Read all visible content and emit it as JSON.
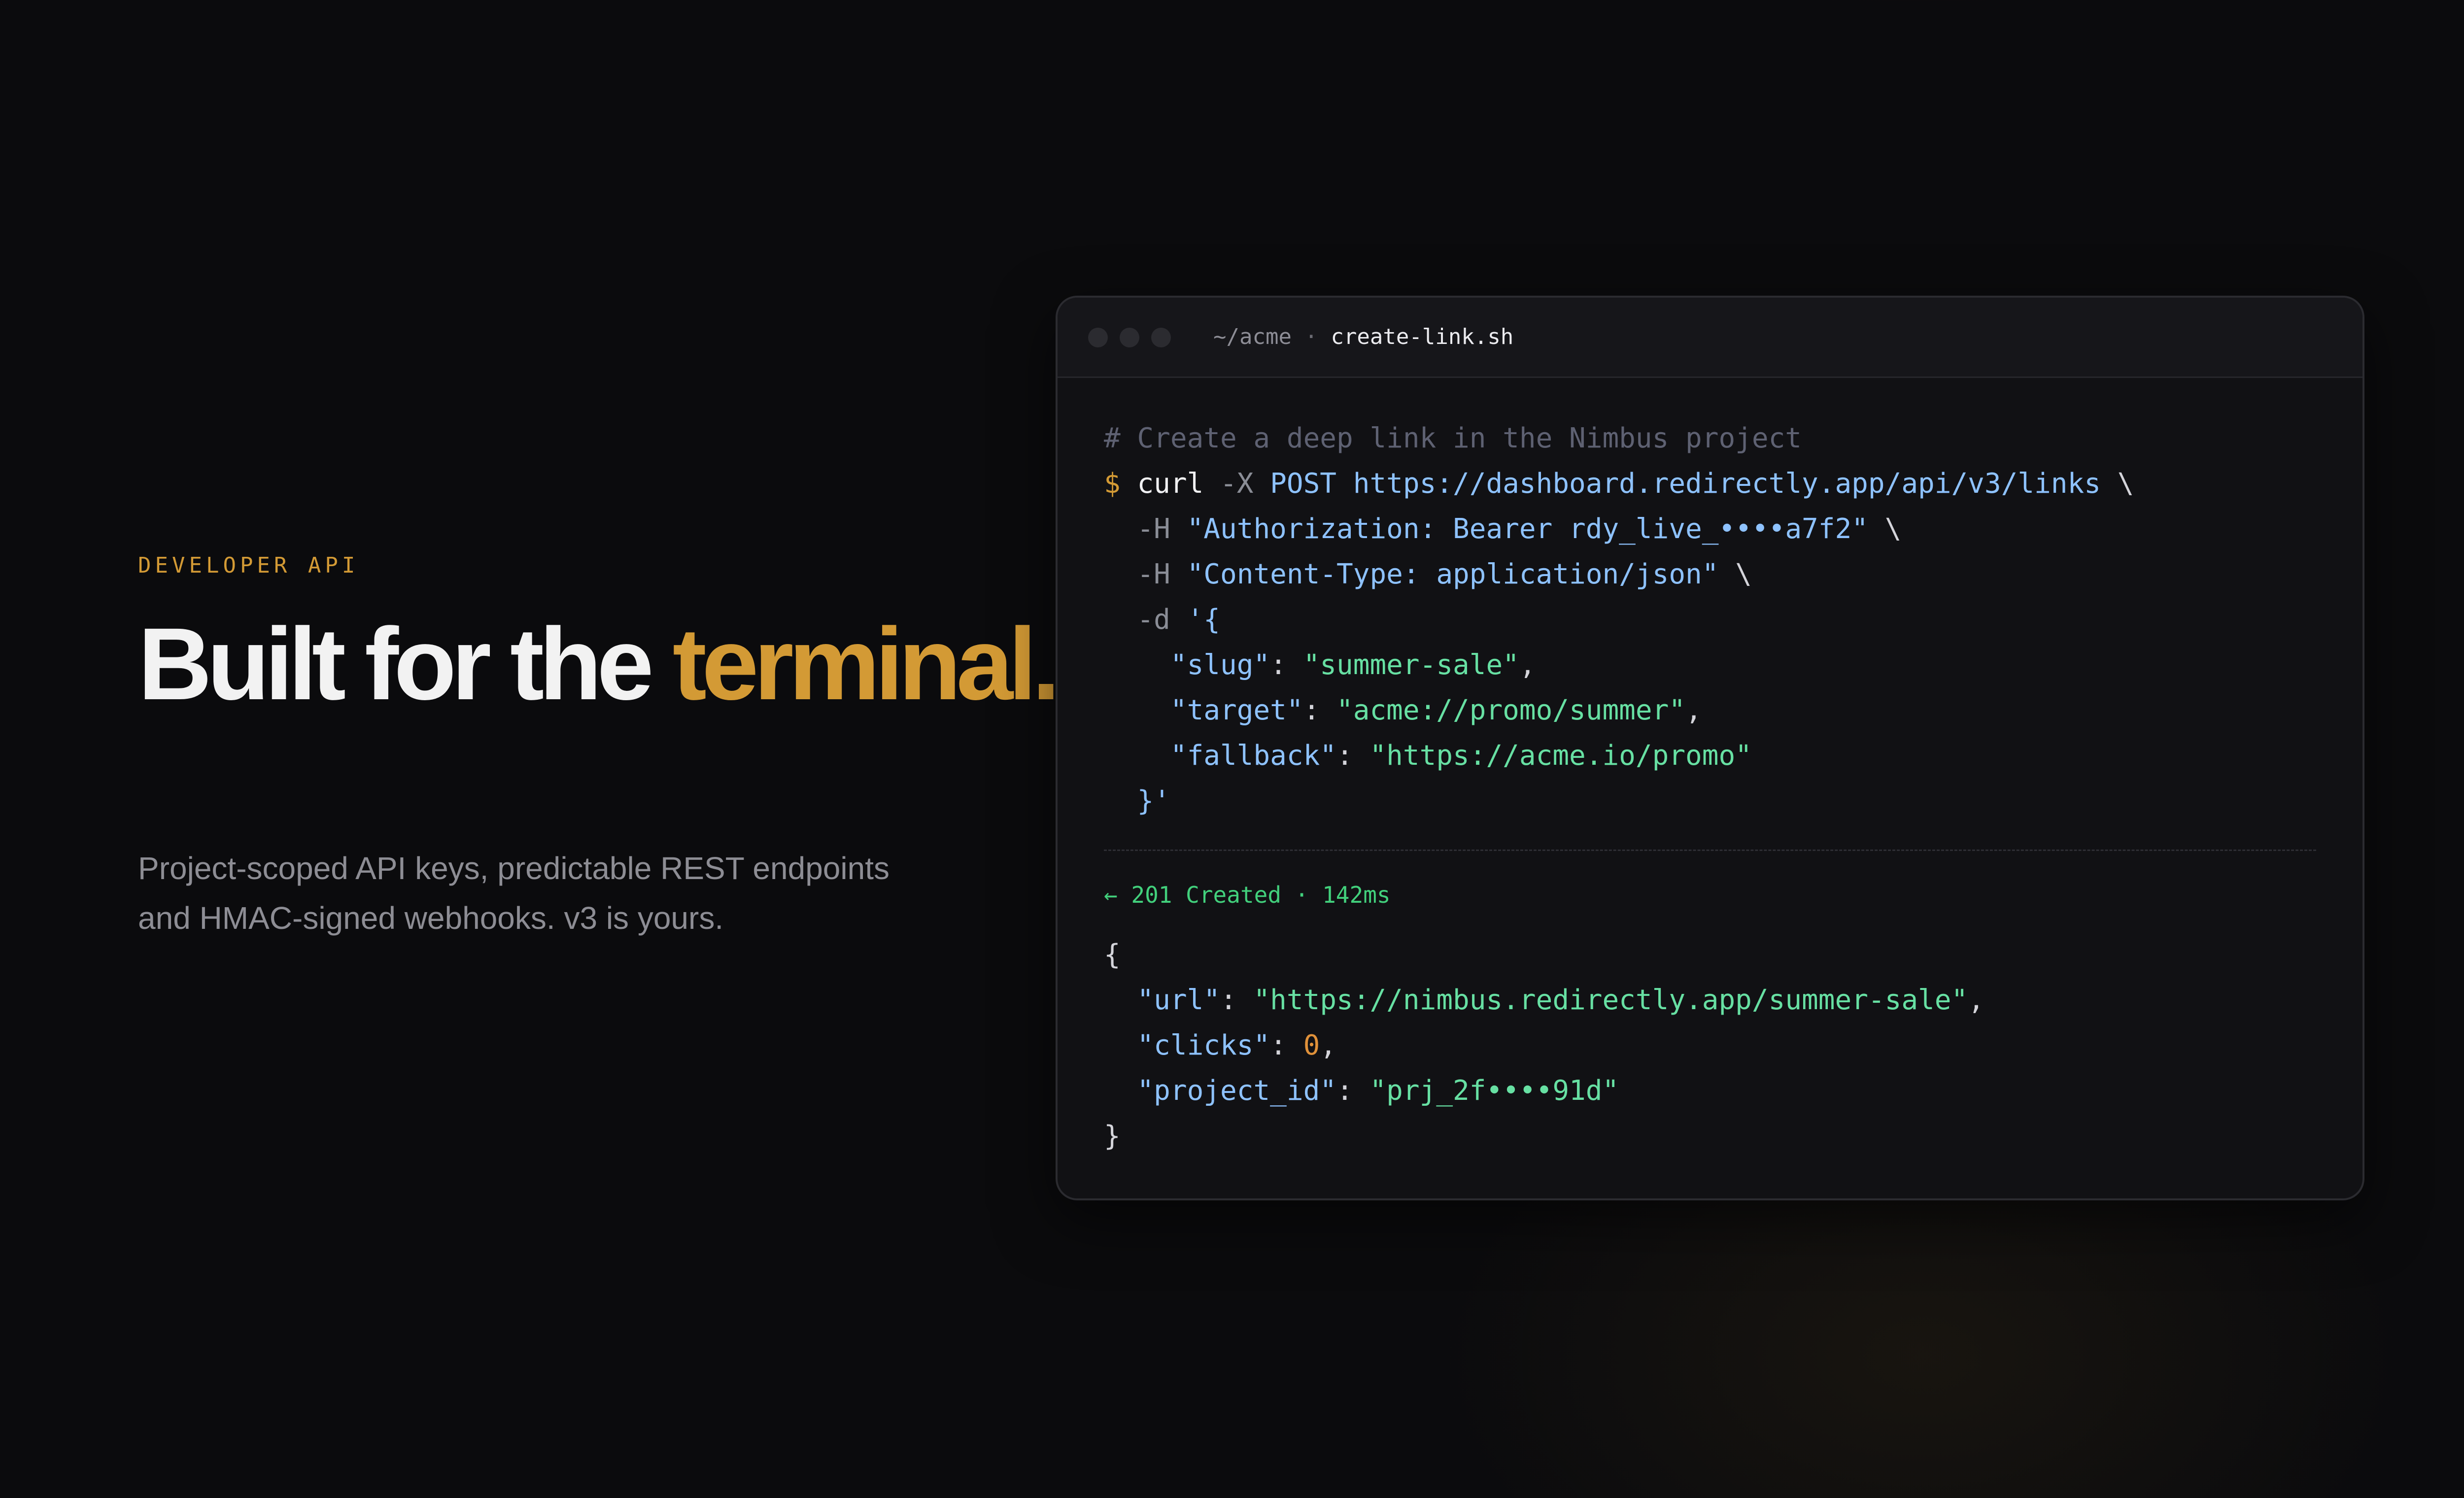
{
  "hero": {
    "eyebrow": "DEVELOPER API",
    "headline_main": "Built for the ",
    "headline_accent": "terminal.",
    "body_line1": "Project-scoped API keys, predictable REST endpoints",
    "body_line2": "and HMAC-signed webhooks. v3 is yours."
  },
  "terminal": {
    "path_dir": "~/acme",
    "path_sep": " · ",
    "filename": "create-link.sh",
    "request": {
      "comment": "# Create a deep link in the Nimbus project",
      "prompt": "$ ",
      "command": "curl",
      "method_flag": " -X ",
      "method": "POST",
      "url": "https://dashboard.redirectly.app/api/v3/links",
      "continuation": " \\",
      "header_flag": "-H ",
      "auth_header": "\"Authorization: Bearer rdy_live_••••a7f2\"",
      "content_type_header": "\"Content-Type: application/json\"",
      "data_flag": "-d ",
      "data_open": "'{",
      "slug_key": "\"slug\"",
      "slug_value": "\"summer-sale\"",
      "target_key": "\"target\"",
      "target_value": "\"acme://promo/summer\"",
      "fallback_key": "\"fallback\"",
      "fallback_value": "\"https://acme.io/promo\"",
      "data_close": "}'"
    },
    "status": "← 201 Created · 142ms",
    "response": {
      "open": "{",
      "url_key": "\"url\"",
      "url_value": "\"https://nimbus.redirectly.app/summer-sale\"",
      "clicks_key": "\"clicks\"",
      "clicks_value": "0",
      "project_key": "\"project_id\"",
      "project_value": "\"prj_2f••••91d\"",
      "close": "}"
    }
  },
  "colors": {
    "accent": "#d39a35",
    "success": "#42d07c",
    "string": "#67e0a3",
    "key": "#8ec2ff",
    "background": "#0b0b0d"
  }
}
